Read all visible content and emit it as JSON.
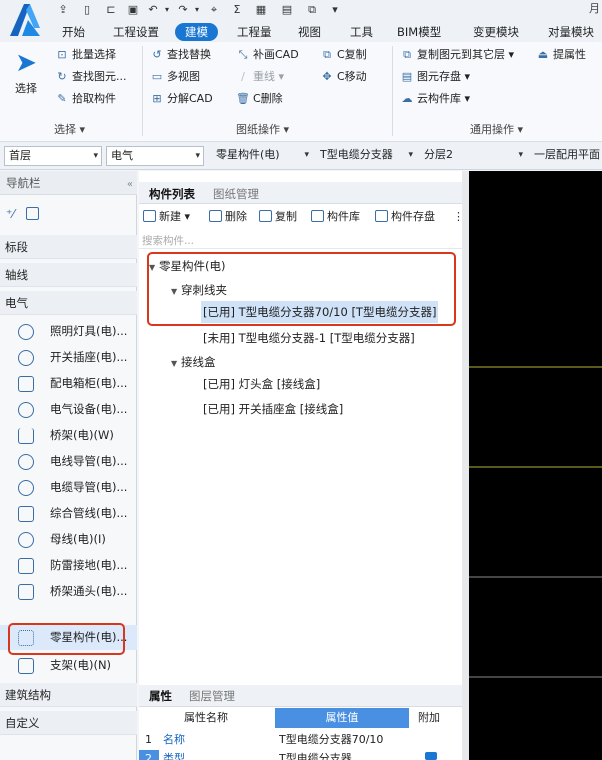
{
  "menu": {
    "tabs": [
      "开始",
      "工程设置",
      "建模",
      "工程量",
      "视图",
      "工具",
      "BIM模型",
      "变更模块",
      "对量模块"
    ],
    "active": "建模",
    "corner_char": "月"
  },
  "ribbon": {
    "select_label": "选择",
    "select_group": "选择 ▾",
    "drawing_group": "图纸操作 ▾",
    "common_group": "通用操作 ▾",
    "items": {
      "batch_select": "批量选择",
      "find_replace": "查找替换",
      "fill_cad": "补画CAD",
      "c_copy": "C复制",
      "copy_to_other_layer": "复制图元到其它层",
      "lift_property": "提属性",
      "find_element": "查找图元...",
      "multi_view": "多视图",
      "retrace": "重线",
      "c_move": "C移动",
      "element_save": "图元存盘",
      "pick_component": "拾取构件",
      "decompose_cad": "分解CAD",
      "c_delete": "C删除",
      "cloud_library": "云构件库"
    }
  },
  "dropdowns": {
    "floor": "首层",
    "discipline": "电气",
    "component_type": "零星构件(电)",
    "component": "T型电缆分支器",
    "layer": "分层2",
    "mode": "一层配用平面"
  },
  "leftnav": {
    "header": "导航栏",
    "categories": {
      "col1": "标段",
      "col2": "轴线",
      "col3": "电气",
      "col4": "建筑结构",
      "col5": "自定义"
    },
    "items": [
      "照明灯具(电)...",
      "开关插座(电)...",
      "配电箱柜(电)...",
      "电气设备(电)...",
      "桥架(电)(W)",
      "电线导管(电)...",
      "电缆导管(电)...",
      "综合管线(电)...",
      "母线(电)(I)",
      "防雷接地(电)...",
      "桥架通头(电)...",
      "零星构件(电)...",
      "支架(电)(N)"
    ],
    "selected_index": 11
  },
  "midpanel": {
    "tab_component_list": "构件列表",
    "tab_drawing_mgmt": "图纸管理",
    "toolbar": {
      "new": "新建",
      "delete": "删除",
      "copy": "复制",
      "library": "构件库",
      "save": "构件存盘",
      "more": "⋮⋮"
    },
    "search_placeholder": "搜索构件...",
    "tree": {
      "root": "零星构件(电)",
      "group1": "穿刺线夹",
      "item1": "[已用] T型电缆分支器70/10 [T型电缆分支器]",
      "item2": "[未用] T型电缆分支器-1 [T型电缆分支器]",
      "group2": "接线盒",
      "item3": "[已用] 灯头盒 [接线盒]",
      "item4": "[已用] 开关插座盒 [接线盒]"
    },
    "props": {
      "tab_props": "属性",
      "tab_layer_mgmt": "图层管理",
      "col_name": "属性名称",
      "col_value": "属性值",
      "col_add": "附加",
      "row1_no": "1",
      "row1_name": "名称",
      "row1_value": "T型电缆分支器70/10",
      "row2_no": "2",
      "row2_name": "类型",
      "row2_value": "T型电缆分支器"
    }
  },
  "colors": {
    "accent": "#1976d2",
    "highlight_red": "#d9361e",
    "canvas": "#000000",
    "canvas_line": "#b8b23a"
  }
}
